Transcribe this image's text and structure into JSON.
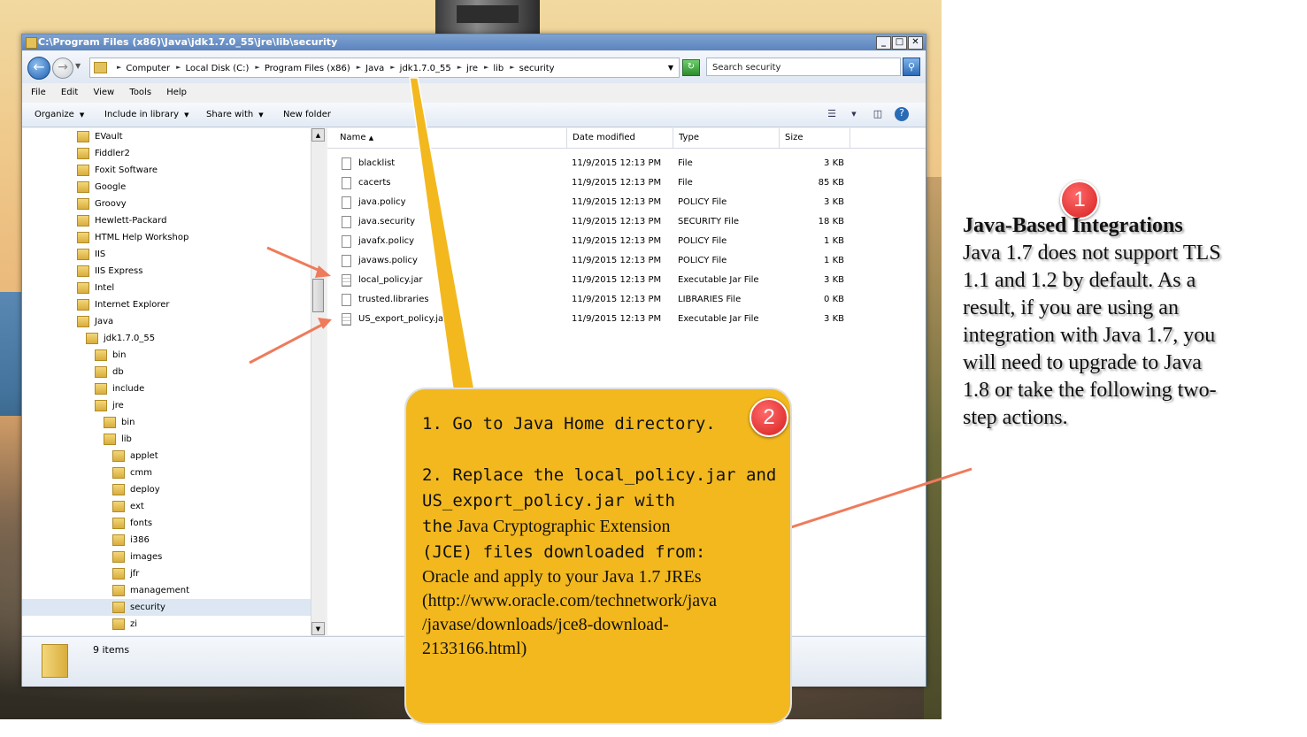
{
  "window": {
    "title": "C:\\Program Files (x86)\\Java\\jdk1.7.0_55\\jre\\lib\\security",
    "controls": [
      "_",
      "□",
      "✕"
    ]
  },
  "address_bar": {
    "crumbs": [
      "Computer",
      "Local Disk (C:)",
      "Program Files (x86)",
      "Java",
      "jdk1.7.0_55",
      "jre",
      "lib",
      "security"
    ],
    "search_placeholder": "Search security"
  },
  "menu": [
    "File",
    "Edit",
    "View",
    "Tools",
    "Help"
  ],
  "toolbar": {
    "organize": "Organize",
    "include": "Include in library",
    "share": "Share with",
    "new_folder": "New folder"
  },
  "tree": [
    {
      "label": "EVault",
      "indent": 0
    },
    {
      "label": "Fiddler2",
      "indent": 0
    },
    {
      "label": "Foxit Software",
      "indent": 0
    },
    {
      "label": "Google",
      "indent": 0
    },
    {
      "label": "Groovy",
      "indent": 0
    },
    {
      "label": "Hewlett-Packard",
      "indent": 0
    },
    {
      "label": "HTML Help Workshop",
      "indent": 0
    },
    {
      "label": "IIS",
      "indent": 0
    },
    {
      "label": "IIS Express",
      "indent": 0
    },
    {
      "label": "Intel",
      "indent": 0
    },
    {
      "label": "Internet Explorer",
      "indent": 0
    },
    {
      "label": "Java",
      "indent": 0
    },
    {
      "label": "jdk1.7.0_55",
      "indent": 1
    },
    {
      "label": "bin",
      "indent": 2
    },
    {
      "label": "db",
      "indent": 2
    },
    {
      "label": "include",
      "indent": 2
    },
    {
      "label": "jre",
      "indent": 2
    },
    {
      "label": "bin",
      "indent": 3
    },
    {
      "label": "lib",
      "indent": 3
    },
    {
      "label": "applet",
      "indent": 4
    },
    {
      "label": "cmm",
      "indent": 4
    },
    {
      "label": "deploy",
      "indent": 4
    },
    {
      "label": "ext",
      "indent": 4
    },
    {
      "label": "fonts",
      "indent": 4
    },
    {
      "label": "i386",
      "indent": 4
    },
    {
      "label": "images",
      "indent": 4
    },
    {
      "label": "jfr",
      "indent": 4
    },
    {
      "label": "management",
      "indent": 4
    },
    {
      "label": "security",
      "indent": 4,
      "selected": true
    },
    {
      "label": "zi",
      "indent": 4
    }
  ],
  "columns": [
    "Name",
    "Date modified",
    "Type",
    "Size"
  ],
  "files": [
    {
      "name": "blacklist",
      "date": "11/9/2015 12:13 PM",
      "type": "File",
      "size": "3 KB",
      "icon": "file"
    },
    {
      "name": "cacerts",
      "date": "11/9/2015 12:13 PM",
      "type": "File",
      "size": "85 KB",
      "icon": "file"
    },
    {
      "name": "java.policy",
      "date": "11/9/2015 12:13 PM",
      "type": "POLICY File",
      "size": "3 KB",
      "icon": "file"
    },
    {
      "name": "java.security",
      "date": "11/9/2015 12:13 PM",
      "type": "SECURITY File",
      "size": "18 KB",
      "icon": "file"
    },
    {
      "name": "javafx.policy",
      "date": "11/9/2015 12:13 PM",
      "type": "POLICY File",
      "size": "1 KB",
      "icon": "file"
    },
    {
      "name": "javaws.policy",
      "date": "11/9/2015 12:13 PM",
      "type": "POLICY File",
      "size": "1 KB",
      "icon": "file"
    },
    {
      "name": "local_policy.jar",
      "date": "11/9/2015 12:13 PM",
      "type": "Executable Jar File",
      "size": "3 KB",
      "icon": "jar"
    },
    {
      "name": "trusted.libraries",
      "date": "11/9/2015 12:13 PM",
      "type": "LIBRARIES File",
      "size": "0 KB",
      "icon": "file"
    },
    {
      "name": "US_export_policy.ja",
      "date": "11/9/2015 12:13 PM",
      "type": "Executable Jar File",
      "size": "3 KB",
      "icon": "jar"
    }
  ],
  "status": {
    "count": "9 items"
  },
  "callout_steps": {
    "badge": "2",
    "step1": "1. Go to Java Home directory.",
    "step2_line1": "2. Replace the local_policy.jar and",
    "step2_line2": "US_export_policy.jar with",
    "step2_line3a": "the",
    "step2_line3b": "Java Cryptographic Extension",
    "step2_line4": "(JCE) files downloaded from:",
    "step2_line5": "Oracle and apply to your Java 1.7 JREs",
    "step2_line6": "(http://www.oracle.com/technetwork/java",
    "step2_line7": "/javase/downloads/jce8-download-",
    "step2_line8": "2133166.html)"
  },
  "callout_note": {
    "badge": "1",
    "heading": "Java-Based Integrations",
    "body": "Java 1.7 does not support TLS 1.1 and 1.2 by default. As a result, if you are using an integration with Java 1.7, you will need to upgrade to Java 1.8 or take the following two-step actions."
  },
  "colors": {
    "callout_yellow": "#f2b81e",
    "badge_red": "#d61f1f",
    "arrow_salmon": "#ee7b5b"
  }
}
